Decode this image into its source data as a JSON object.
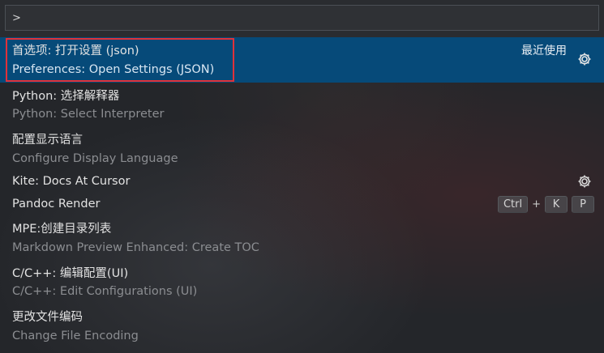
{
  "input": {
    "value": ">"
  },
  "items": [
    {
      "label": "首选项: 打开设置 (json)",
      "detail": "Preferences: Open Settings (JSON)",
      "badge": "最近使用",
      "gear": "gear-icon"
    },
    {
      "label": "Python: 选择解释器",
      "detail": "Python: Select Interpreter"
    },
    {
      "label": "配置显示语言",
      "detail": "Configure Display Language"
    },
    {
      "label": "Kite: Docs At Cursor",
      "gear": "gear-icon"
    },
    {
      "label": "Pandoc Render",
      "keys": [
        "Ctrl",
        "+",
        "K",
        "P"
      ]
    },
    {
      "label": "MPE:创建目录列表",
      "detail": "Markdown Preview Enhanced: Create TOC"
    },
    {
      "label": "C/C++: 编辑配置(UI)",
      "detail": "C/C++: Edit Configurations (UI)"
    },
    {
      "label": "更改文件编码",
      "detail": "Change File Encoding"
    }
  ],
  "colors": {
    "selected_bg": "#064a79",
    "highlight_border": "#e0323a"
  }
}
